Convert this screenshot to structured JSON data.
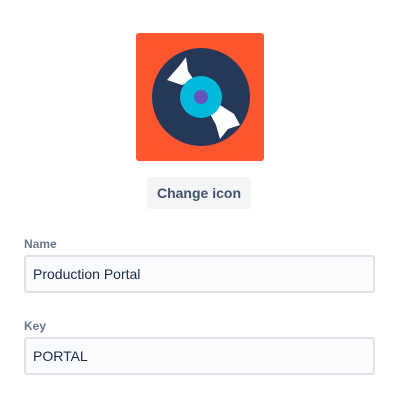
{
  "project_avatar": {
    "icon": "vinyl-record-icon",
    "background_color": "#ff5630",
    "disc_color": "#253858",
    "label_color": "#00b8d9",
    "spindle_color": "#6554c0",
    "shine_color": "#ffffff"
  },
  "change_icon_button": {
    "label": "Change icon",
    "background_color": "#f4f5f7"
  },
  "form": {
    "name": {
      "label": "Name",
      "value": "Production Portal"
    },
    "key": {
      "label": "Key",
      "value": "PORTAL"
    },
    "input_background": "#fafbfc",
    "input_border": "#dfe1e6"
  }
}
